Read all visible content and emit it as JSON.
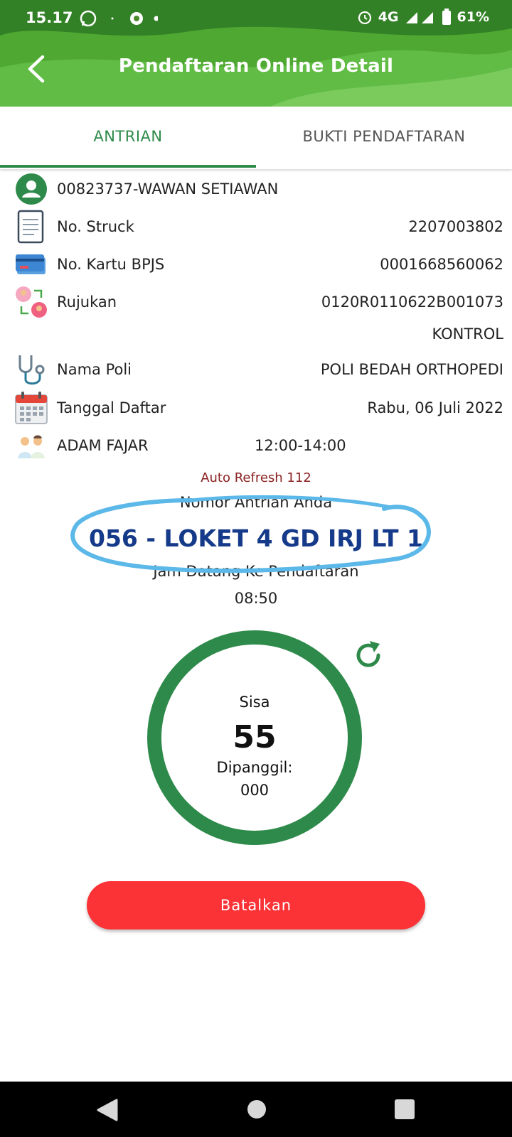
{
  "status_bar": {
    "time": "15.17",
    "network": "4G",
    "battery": "61%"
  },
  "header": {
    "title": "Pendaftaran Online Detail"
  },
  "tabs": [
    {
      "label": "ANTRIAN",
      "active": true
    },
    {
      "label": "BUKTI PENDAFTARAN",
      "active": false
    }
  ],
  "patient": {
    "name": "00823737-WAWAN SETIAWAN"
  },
  "rows": {
    "struck": {
      "label": "No. Struck",
      "value": "2207003802"
    },
    "bpjs": {
      "label": "No. Kartu BPJS",
      "value": "0001668560062"
    },
    "rujukan": {
      "label": "Rujukan",
      "value": "0120R0110622B001073",
      "note": "KONTROL"
    },
    "poli": {
      "label": "Nama Poli",
      "value": "POLI BEDAH ORTHOPEDI"
    },
    "tanggal": {
      "label": "Tanggal Daftar",
      "value": "Rabu, 06 Juli 2022"
    },
    "doctor": {
      "label": "ADAM FAJAR",
      "time": "12:00-14:00"
    }
  },
  "queue": {
    "auto_refresh": "Auto Refresh 112",
    "label": "Nomor Antrian Anda",
    "number": "056 - LOKET 4 GD IRJ LT 1",
    "arrival_label": "Jam Datang Ke Pendaftaran",
    "arrival_time": "08:50"
  },
  "counter": {
    "remaining_label": "Sisa",
    "remaining_value": "55",
    "called_label": "Dipanggil:",
    "called_value": "000"
  },
  "actions": {
    "cancel_label": "Batalkan"
  },
  "colors": {
    "header_green": "#4ea832",
    "accent_green": "#2e8a4a",
    "cancel_red": "#fb3236",
    "queue_blue": "#153a8a",
    "auto_refresh_red": "#8a1f1f",
    "highlight_scribble": "#5bb8e8"
  },
  "icons": {
    "back": "arrow-left-icon",
    "refresh": "refresh-icon",
    "whatsapp": "whatsapp-icon",
    "alarm": "alarm-icon"
  }
}
